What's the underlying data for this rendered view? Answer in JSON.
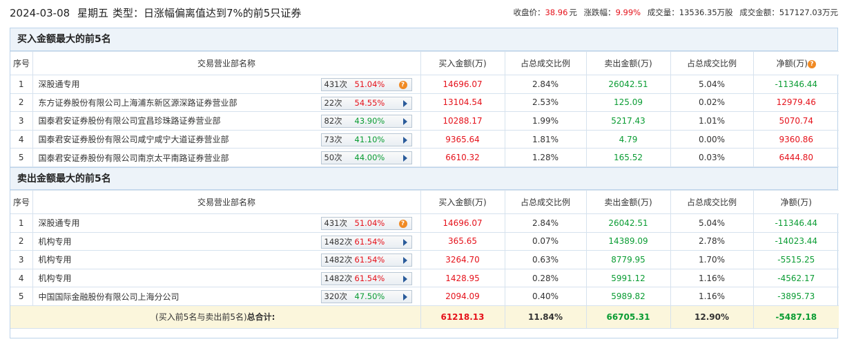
{
  "header": {
    "date": "2024-03-08",
    "weekday": "星期五",
    "type_label": "类型：",
    "type_value": "日涨幅偏离值达到7%的前5只证券",
    "close_label": "收盘价：",
    "close_value": "38.96",
    "close_unit": "元",
    "change_label": "涨跌幅：",
    "change_value": "9.99%",
    "volume_label": "成交量：",
    "volume_value": "13536.35万股",
    "amount_label": "成交金额：",
    "amount_value": "517127.03万元"
  },
  "columns": {
    "seq": "序号",
    "name": "交易营业部名称",
    "buy": "买入金额(万)",
    "buy_ratio": "占总成交比例",
    "sell": "卖出金额(万)",
    "sell_ratio": "占总成交比例",
    "net": "净额(万)"
  },
  "buy_section": {
    "title": "买入金额最大的前5名",
    "rows": [
      {
        "seq": "1",
        "name": "深股通专用",
        "count": "431次",
        "pct": "51.04%",
        "pct_color": "red",
        "icon": "question-icon",
        "buy": "14696.07",
        "buy_ratio": "2.84%",
        "sell": "26042.51",
        "sell_ratio": "5.04%",
        "net": "-11346.44",
        "net_color": "green"
      },
      {
        "seq": "2",
        "name": "东方证券股份有限公司上海浦东新区源深路证券营业部",
        "count": "22次",
        "pct": "54.55%",
        "pct_color": "red",
        "icon": "arrow-icon",
        "buy": "13104.54",
        "buy_ratio": "2.53%",
        "sell": "125.09",
        "sell_ratio": "0.02%",
        "net": "12979.46",
        "net_color": "red"
      },
      {
        "seq": "3",
        "name": "国泰君安证券股份有限公司宜昌珍珠路证券营业部",
        "count": "82次",
        "pct": "43.90%",
        "pct_color": "green",
        "icon": "arrow-icon",
        "buy": "10288.17",
        "buy_ratio": "1.99%",
        "sell": "5217.43",
        "sell_ratio": "1.01%",
        "net": "5070.74",
        "net_color": "red"
      },
      {
        "seq": "4",
        "name": "国泰君安证券股份有限公司咸宁咸宁大道证券营业部",
        "count": "73次",
        "pct": "41.10%",
        "pct_color": "green",
        "icon": "arrow-icon",
        "buy": "9365.64",
        "buy_ratio": "1.81%",
        "sell": "4.79",
        "sell_ratio": "0.00%",
        "net": "9360.86",
        "net_color": "red"
      },
      {
        "seq": "5",
        "name": "国泰君安证券股份有限公司南京太平南路证券营业部",
        "count": "50次",
        "pct": "44.00%",
        "pct_color": "green",
        "icon": "arrow-icon",
        "buy": "6610.32",
        "buy_ratio": "1.28%",
        "sell": "165.52",
        "sell_ratio": "0.03%",
        "net": "6444.80",
        "net_color": "red"
      }
    ]
  },
  "sell_section": {
    "title": "卖出金额最大的前5名",
    "net_header": "净额(万)",
    "rows": [
      {
        "seq": "1",
        "name": "深股通专用",
        "count": "431次",
        "pct": "51.04%",
        "pct_color": "red",
        "icon": "question-icon",
        "buy": "14696.07",
        "buy_ratio": "2.84%",
        "sell": "26042.51",
        "sell_ratio": "5.04%",
        "net": "-11346.44",
        "net_color": "green"
      },
      {
        "seq": "2",
        "name": "机构专用",
        "count": "1482次",
        "pct": "61.54%",
        "pct_color": "red",
        "icon": "arrow-icon",
        "buy": "365.65",
        "buy_ratio": "0.07%",
        "sell": "14389.09",
        "sell_ratio": "2.78%",
        "net": "-14023.44",
        "net_color": "green"
      },
      {
        "seq": "3",
        "name": "机构专用",
        "count": "1482次",
        "pct": "61.54%",
        "pct_color": "red",
        "icon": "arrow-icon",
        "buy": "3264.70",
        "buy_ratio": "0.63%",
        "sell": "8779.95",
        "sell_ratio": "1.70%",
        "net": "-5515.25",
        "net_color": "green"
      },
      {
        "seq": "4",
        "name": "机构专用",
        "count": "1482次",
        "pct": "61.54%",
        "pct_color": "red",
        "icon": "arrow-icon",
        "buy": "1428.95",
        "buy_ratio": "0.28%",
        "sell": "5991.12",
        "sell_ratio": "1.16%",
        "net": "-4562.17",
        "net_color": "green"
      },
      {
        "seq": "5",
        "name": "中国国际金融股份有限公司上海分公司",
        "count": "320次",
        "pct": "47.50%",
        "pct_color": "green",
        "icon": "arrow-icon",
        "buy": "2094.09",
        "buy_ratio": "0.40%",
        "sell": "5989.82",
        "sell_ratio": "1.16%",
        "net": "-3895.73",
        "net_color": "green"
      }
    ]
  },
  "total": {
    "label_prefix": "(买入前5名与卖出前5名)",
    "label_bold": "总合计:",
    "buy": "61218.13",
    "buy_ratio": "11.84%",
    "sell": "66705.31",
    "sell_ratio": "12.90%",
    "net": "-5487.18"
  },
  "colors": {
    "red": "#e5121b",
    "green": "#0a9c33",
    "section_bg": "#edf3f9",
    "total_bg": "#fbf6dc",
    "border": "#bcd3ea"
  }
}
